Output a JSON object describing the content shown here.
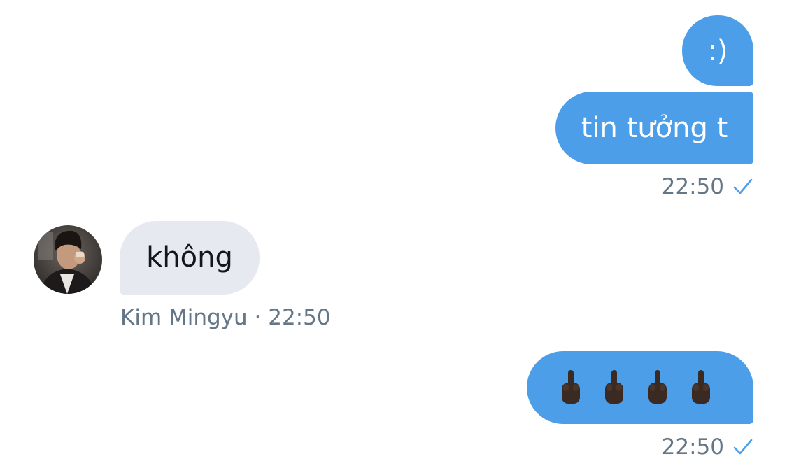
{
  "messages": [
    {
      "direction": "outgoing",
      "text": ":)"
    },
    {
      "direction": "outgoing",
      "text": "tin tưởng t"
    },
    {
      "direction": "outgoing_meta",
      "time": "22:50",
      "status_icon": "sent-check-icon"
    },
    {
      "direction": "incoming",
      "sender": "Kim Mingyu",
      "text": "không"
    },
    {
      "direction": "incoming_meta",
      "meta": "Kim Mingyu · 22:50"
    },
    {
      "direction": "outgoing",
      "emoji": [
        "middle-finger-emoji",
        "middle-finger-emoji",
        "middle-finger-emoji",
        "middle-finger-emoji"
      ]
    },
    {
      "direction": "outgoing_meta",
      "time": "22:50",
      "status_icon": "sent-check-icon"
    }
  ],
  "colors": {
    "outgoing_bubble": "#4c9ee8",
    "incoming_bubble": "#e6e9f0",
    "meta_text": "#657786",
    "check": "#4c9ee8"
  }
}
